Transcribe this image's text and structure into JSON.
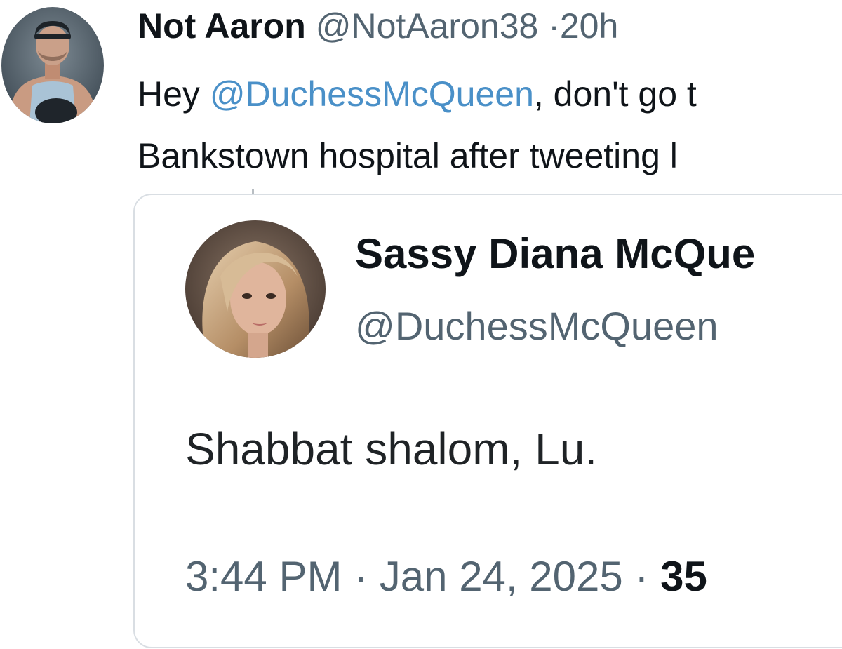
{
  "tweet": {
    "author": {
      "display_name": "Not Aaron",
      "handle": "@NotAaron38",
      "avatar_icon": "user-avatar-photo"
    },
    "separator": "·",
    "time": "20h",
    "text": {
      "line1_prefix": "Hey ",
      "mention": "@DuchessMcQueen",
      "line1_suffix": ", don't go t",
      "line2": "Bankstown hospital after tweeting l"
    }
  },
  "quoted_tweet": {
    "author": {
      "display_name": "Sassy Diana McQue",
      "handle": "@DuchessMcQueen",
      "avatar_icon": "user-avatar-photo"
    },
    "text": "Shabbat shalom, Lu.",
    "timestamp": "3:44 PM",
    "separator": "·",
    "date": "Jan 24, 2025",
    "count_partial": "35"
  },
  "colors": {
    "text_primary": "#0f1419",
    "text_secondary": "#536471",
    "mention": "#4a90c8",
    "card_border": "#d9dee3"
  }
}
